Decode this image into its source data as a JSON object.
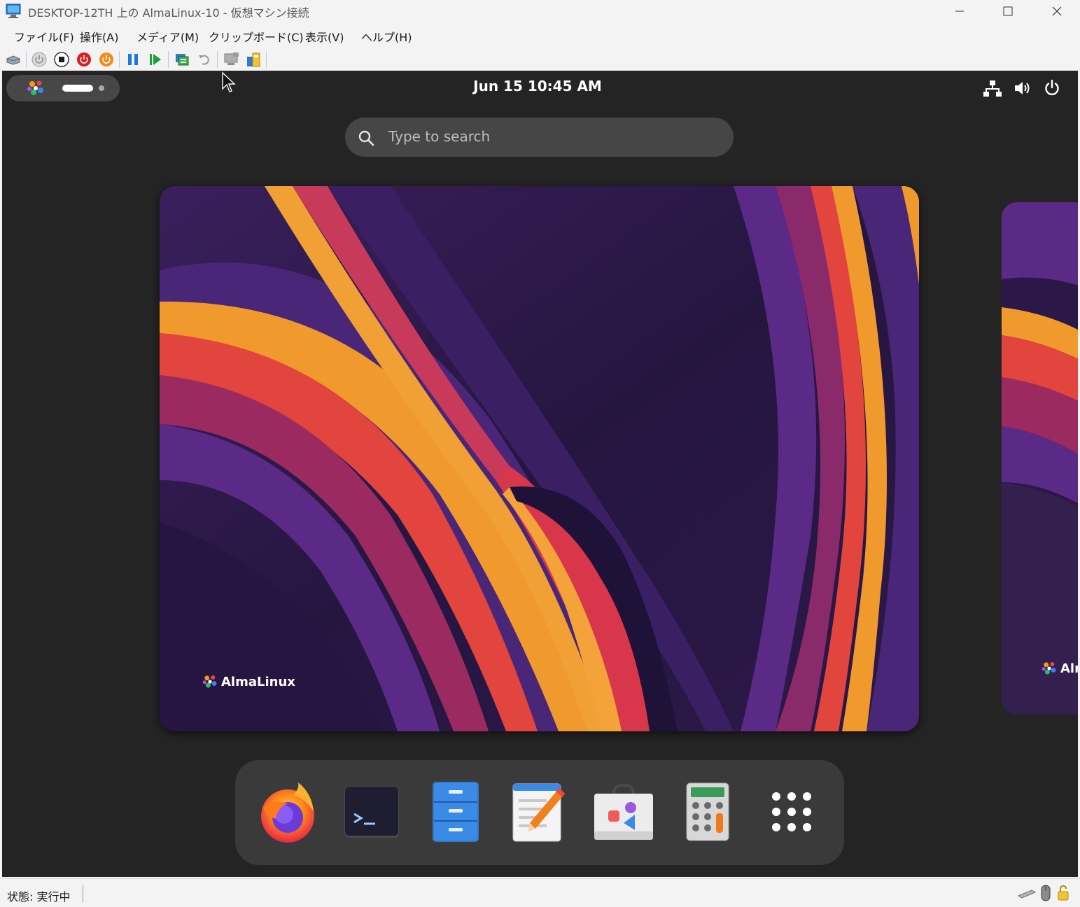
{
  "window": {
    "title": "DESKTOP-12TH 上の AlmaLinux-10 - 仮想マシン接続",
    "minimize_icon": "minimize-icon",
    "maximize_icon": "maximize-icon",
    "close_icon": "close-icon"
  },
  "menu": [
    {
      "label": "ファイル(F)"
    },
    {
      "label": "操作(A)"
    },
    {
      "label": "メディア(M)"
    },
    {
      "label": "クリップボード(C)"
    },
    {
      "label": "表示(V)"
    },
    {
      "label": "ヘルプ(H)"
    }
  ],
  "toolbar": {
    "icons": [
      "ctrl-alt-del-icon",
      "start-icon",
      "turn-off-icon",
      "shutdown-icon",
      "save-icon",
      "pause-icon",
      "resume-icon",
      "checkpoint-icon",
      "revert-icon",
      "enhanced-session-icon",
      "share-icon"
    ]
  },
  "topbar": {
    "clock": "Jun 15  10:45 AM",
    "status_icons": [
      "network-icon",
      "volume-icon",
      "power-icon"
    ]
  },
  "search": {
    "placeholder": "Type to search"
  },
  "workspace": {
    "brand": "AlmaLinux",
    "brand_partial": "Alm"
  },
  "dock": {
    "apps": [
      "firefox-icon",
      "terminal-icon",
      "files-icon",
      "text-editor-icon",
      "software-icon",
      "calculator-icon",
      "show-apps-icon"
    ]
  },
  "statusbar": {
    "text": "状態: 実行中"
  },
  "colors": {
    "vm_background": "#242424",
    "wallpaper_base": "#2a1840",
    "wallpaper_orange": "#f08a2c",
    "wallpaper_red": "#d8364a",
    "wallpaper_purple": "#5a2a8a"
  }
}
